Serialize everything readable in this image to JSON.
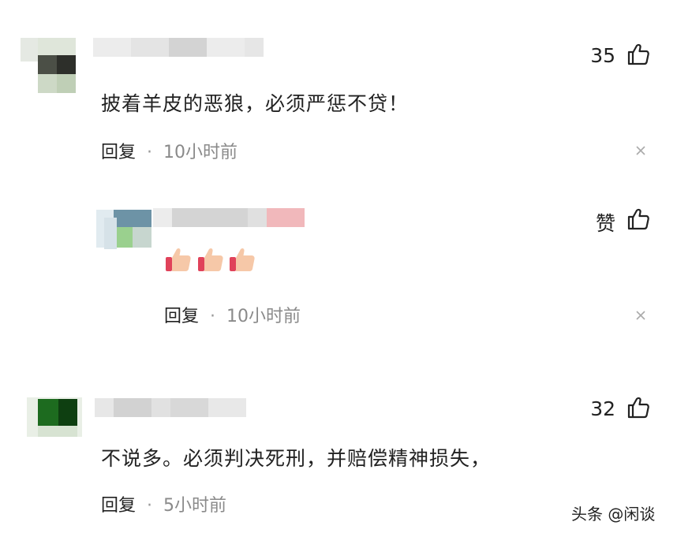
{
  "comments": [
    {
      "text": "披着羊皮的恶狼，必须严惩不贷！",
      "reply_label": "回复",
      "separator": "·",
      "time": "10小时前",
      "likes": "35"
    },
    {
      "text": "👍👍👍",
      "reply_label": "回复",
      "separator": "·",
      "time": "10小时前",
      "likes": "赞"
    },
    {
      "text": "不说多。必须判决死刑，并赔偿精神损失，",
      "reply_label": "回复",
      "separator": "·",
      "time": "5小时前",
      "likes": "32"
    }
  ],
  "watermark": "头条 @闲谈",
  "icons": {
    "like": "thumbs-up-outline-icon",
    "close": "close-icon",
    "emoji": "thumbs-up-emoji"
  },
  "colors": {
    "text": "#222222",
    "time": "#8a8a8a",
    "emoji_skin": "#f6c8a8",
    "emoji_cuff": "#e0425a"
  }
}
